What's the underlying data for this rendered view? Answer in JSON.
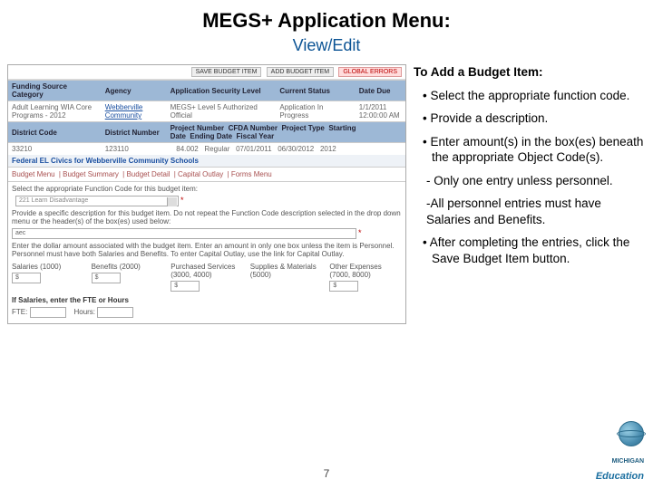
{
  "header": {
    "title": "MEGS+ Application Menu:",
    "subtitle": "View/Edit"
  },
  "right_panel": {
    "heading": "To Add a Budget Item:",
    "bullets": [
      "Select the appropriate function code.",
      "Provide a description.",
      "Enter amount(s) in the box(es) beneath the appropriate Object Code(s)."
    ],
    "sub_bullets": [
      "- Only one entry unless personnel.",
      "-All personnel entries must have Salaries and Benefits."
    ],
    "bullet_last": "After completing the entries, click the Save Budget Item button."
  },
  "shot": {
    "toolbar": {
      "save": "SAVE BUDGET ITEM",
      "add": "ADD BUDGET ITEM",
      "errors": "GLOBAL ERRORS"
    },
    "headers1": [
      "Funding Source Category",
      "Agency",
      "Application Security Level",
      "Current Status",
      "Date Due"
    ],
    "row1": {
      "c1": "Adult Learning WIA Core Programs - 2012",
      "c2": "Webberville Community",
      "c3": "MEGS+ Level 5 Authorized Official",
      "c4": "Application In Progress",
      "c5a": "1/1/2011",
      "c5b": "12:00:00 AM"
    },
    "headers2": [
      "District Code",
      "District Number",
      "Project Number",
      "CFDA Number",
      "Project Type",
      "Starting Date",
      "Ending Date",
      "Fiscal Year"
    ],
    "row2": [
      "33210",
      "123110",
      "",
      "84.002",
      "Regular",
      "07/01/2011",
      "06/30/2012",
      "2012"
    ],
    "project_title": "Federal EL Civics for Webberville Community Schools",
    "nav": [
      "Budget Menu",
      "Budget Summary",
      "Budget Detail",
      "Capital Outlay",
      "Forms Menu"
    ],
    "func_label": "Select the appropriate Function Code for this budget item:",
    "func_value": "221 Learn Disadvantage",
    "desc_label": "Provide a specific description for this budget item. Do not repeat the Function Code description selected in the drop down menu or the header(s) of the box(es) used below:",
    "desc_value": "aec",
    "amount_label": "Enter the dollar amount associated with the budget item. Enter an amount in only one box unless the item is Personnel. Personnel must have both Salaries and Benefits. To enter Capital Outlay, use the link for Capital Outlay.",
    "cols": [
      {
        "lbl": "Salaries (1000)",
        "val": "$"
      },
      {
        "lbl": "Benefits (2000)",
        "val": "$"
      },
      {
        "lbl": "Purchased Services (3000, 4000)",
        "val": "$"
      },
      {
        "lbl": "Supplies & Materials (5000)",
        "val": ""
      },
      {
        "lbl": "Other Expenses (7000, 8000)",
        "val": "$"
      }
    ],
    "fte_label": "If Salaries, enter the FTE or Hours",
    "fte_ftelabel": "FTE:",
    "fte_hourslabel": "Hours:"
  },
  "footer": {
    "page": "7",
    "logo_line1": "MICHIGAN",
    "logo_line2": "Education"
  }
}
